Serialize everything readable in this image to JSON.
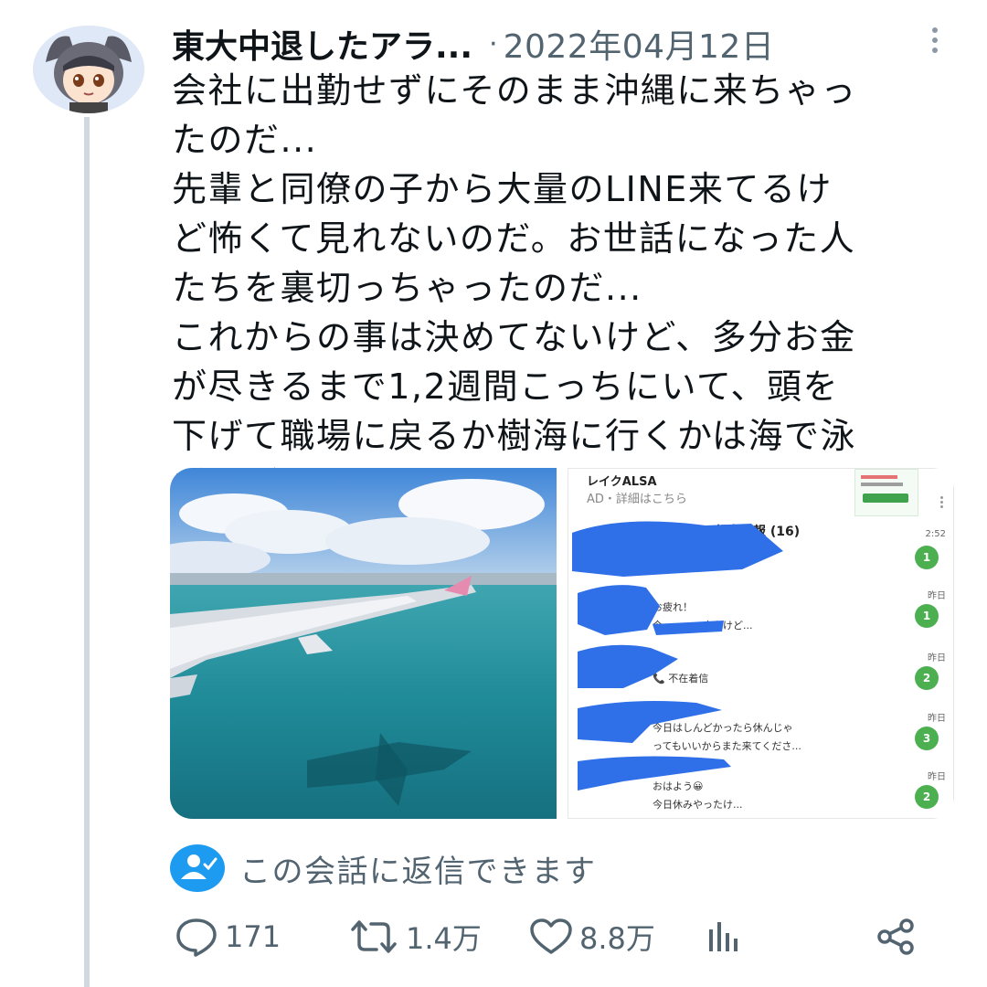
{
  "tweet": {
    "author_name": "東大中退したアラ...",
    "separator": "·",
    "date": "2022年04月12日",
    "text": "会社に出勤せずにそのまま沖縄に来ちゃっ\nたのだ...\n先輩と同僚の子から大量のLINE来てるけ\nど怖くて見れないのだ。お世話になった人\nたちを裏切っちゃったのだ...\nこれからの事は決めてないけど、多分お金\nが尽きるまで1,2週間こっちにいて、頭を\n下げて職場に戻るか樹海に行くかは海で泳\nぎながら考えるのだ"
  },
  "screenshot": {
    "ad_title": "レイクALSA",
    "ad_sub": "AD・詳細はこちら",
    "group_title": "顧客情報 (16)",
    "chats": [
      {
        "message": "",
        "time": "2:52",
        "badge": "1"
      },
      {
        "message": "お疲れ！\n今　　　　来たけど...",
        "time": "昨日",
        "badge": "1"
      },
      {
        "message": "📞 不在着信",
        "time": "昨日",
        "badge": "2"
      },
      {
        "message": "今日はしんどかったら休んじゃ\nってもいいからまた来てくださ...",
        "time": "昨日",
        "badge": "3"
      },
      {
        "message": "おはよう😀\n今日休みやったけ...",
        "time": "昨日",
        "badge": "2"
      }
    ]
  },
  "reply_note": "この会話に返信できます",
  "actions": {
    "replies": "171",
    "retweets": "1.4万",
    "likes": "8.8万"
  },
  "colors": {
    "accent": "#1d9bf0",
    "muted": "#536471",
    "line_green": "#4caf50",
    "scribble_blue": "#2f6fe8"
  },
  "icons": [
    "more-icon",
    "reply-permission-icon",
    "reply-icon",
    "retweet-icon",
    "like-icon",
    "analytics-icon",
    "share-icon"
  ]
}
